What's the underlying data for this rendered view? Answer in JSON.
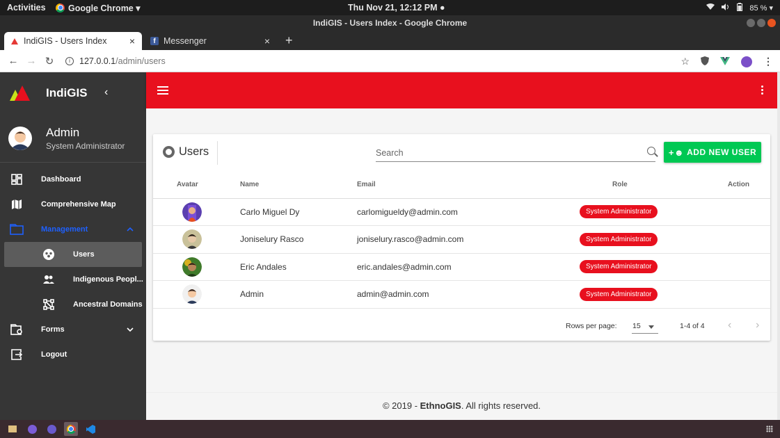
{
  "gnome": {
    "activities": "Activities",
    "app_menu": "Google Chrome ▾",
    "clock": "Thu Nov 21, 12:12 PM ●",
    "battery": "85 % ▾"
  },
  "window": {
    "title": "IndiGIS - Users Index - Google Chrome"
  },
  "tabs": [
    {
      "label": "IndiGIS - Users Index",
      "close": "×"
    },
    {
      "label": "Messenger",
      "close": "×"
    }
  ],
  "omnibar": {
    "host": "127.0.0.1",
    "path": "/admin/users"
  },
  "sidebar": {
    "brand": "IndiGIS",
    "user": {
      "name": "Admin",
      "role": "System Administrator"
    },
    "items": [
      {
        "label": "Dashboard",
        "icon": "dashboard-icon"
      },
      {
        "label": "Comprehensive Map",
        "icon": "map-icon"
      },
      {
        "label": "Management",
        "icon": "folder-icon"
      },
      {
        "label": "Users",
        "icon": "users-icon"
      },
      {
        "label": "Indigenous Peopl...",
        "icon": "people-icon"
      },
      {
        "label": "Ancestral Domains",
        "icon": "domains-icon"
      },
      {
        "label": "Forms",
        "icon": "forms-icon"
      },
      {
        "label": "Logout",
        "icon": "logout-icon"
      }
    ]
  },
  "card": {
    "title": "Users",
    "search_placeholder": "Search",
    "add_label": "ADD NEW USER",
    "columns": [
      "Avatar",
      "Name",
      "Email",
      "Role",
      "Action"
    ],
    "rows": [
      {
        "name": "Carlo Miguel Dy",
        "email": "carlomigueldy@admin.com",
        "role": "System Administrator"
      },
      {
        "name": "Joniselury Rasco",
        "email": "joniselury.rasco@admin.com",
        "role": "System Administrator"
      },
      {
        "name": "Eric Andales",
        "email": "eric.andales@admin.com",
        "role": "System Administrator"
      },
      {
        "name": "Admin",
        "email": "admin@admin.com",
        "role": "System Administrator"
      }
    ],
    "pager": {
      "rows_per_page_label": "Rows per page:",
      "rows_per_page": "15",
      "range": "1-4 of 4"
    }
  },
  "footer": {
    "prefix": "© 2019 - ",
    "brand": "EthnoGIS",
    "suffix": ". All rights reserved."
  },
  "colors": {
    "primary": "#e8101e",
    "success": "#00c853",
    "sidebar": "#363636",
    "active_group": "#1e60ff"
  }
}
